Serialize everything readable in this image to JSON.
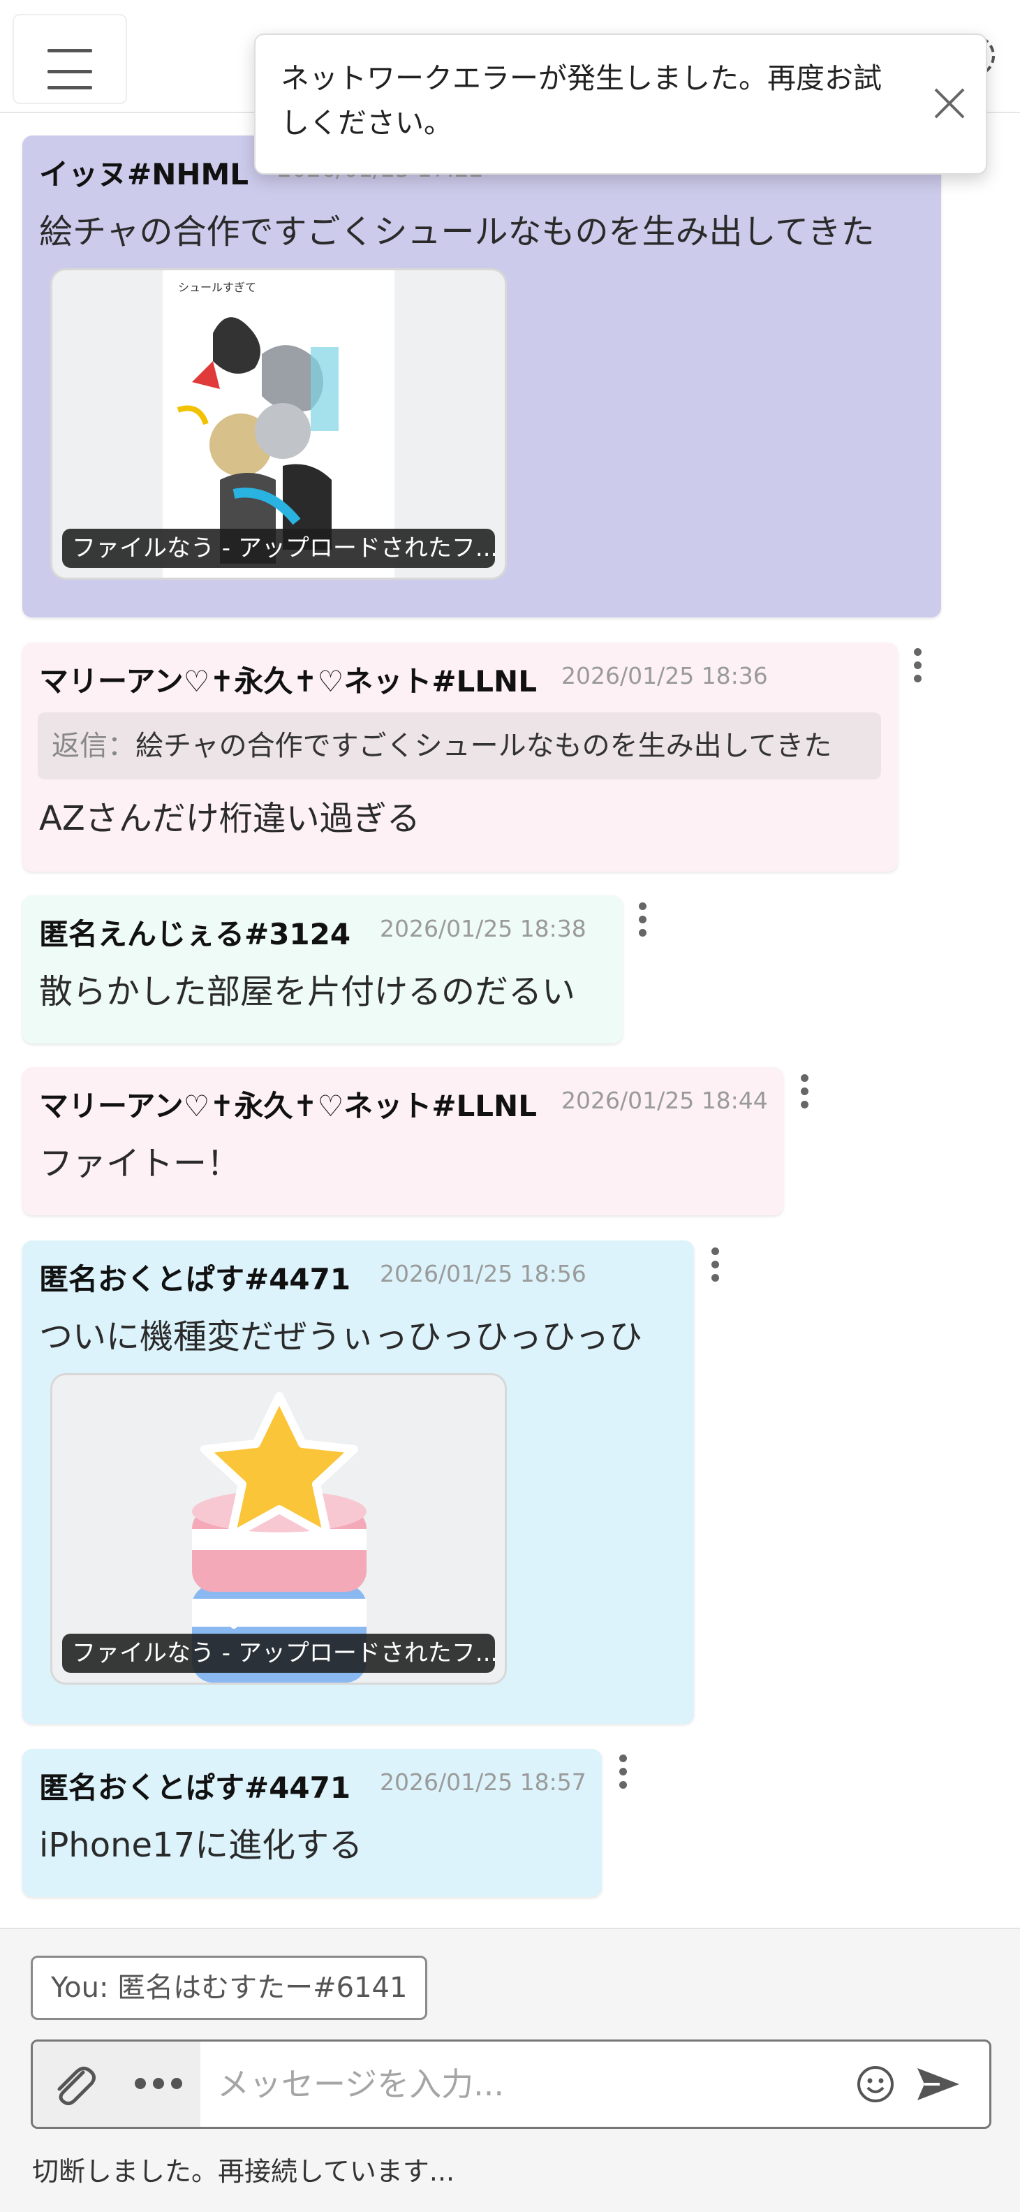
{
  "toast": {
    "message": "ネットワークエラーが発生しました。再度お試しください。"
  },
  "messages": [
    {
      "author": "イッヌ#NHML",
      "time": "2026/01/25 17:22",
      "text": "絵チャの合作ですごくシュールなものを生み出してきた",
      "attachment_caption": "ファイルなう - アップロードされたフ...",
      "color": "#cccbeb"
    },
    {
      "author": "マリーアン♡✝永久✝♡ネット#LLNL",
      "time": "2026/01/25 18:36",
      "reply_label": "返信：",
      "reply_text": "絵チャの合作ですごくシュールなものを生み出してきた",
      "text": "AZさんだけ桁違い過ぎる",
      "color": "#fdf1f5"
    },
    {
      "author": "匿名えんじぇる#3124",
      "time": "2026/01/25 18:38",
      "text": "散らかした部屋を片付けるのだるい",
      "color": "#effbf6"
    },
    {
      "author": "マリーアン♡✝永久✝♡ネット#LLNL",
      "time": "2026/01/25 18:44",
      "text": "ファイトー！",
      "color": "#fdf1f5"
    },
    {
      "author": "匿名おくとぱす#4471",
      "time": "2026/01/25 18:56",
      "text": "ついに機種変だぜうぃっひっひっひっひ",
      "attachment_caption": "ファイルなう - アップロードされたフ...",
      "color": "#dcf3fb"
    },
    {
      "author": "匿名おくとぱす#4471",
      "time": "2026/01/25 18:57",
      "text": "iPhone17に進化する",
      "color": "#dcf3fb"
    }
  ],
  "composer": {
    "you_label": "You: 匿名はむすたー#6141",
    "placeholder": "メッセージを入力...",
    "status": "切断しました。再接続しています..."
  },
  "icons": {
    "menu": "hamburger-menu-icon",
    "close": "close-icon",
    "attach": "paperclip-icon",
    "more": "more-horizontal-icon",
    "emoji": "emoji-icon",
    "send": "send-icon",
    "settings": "gear-icon"
  }
}
